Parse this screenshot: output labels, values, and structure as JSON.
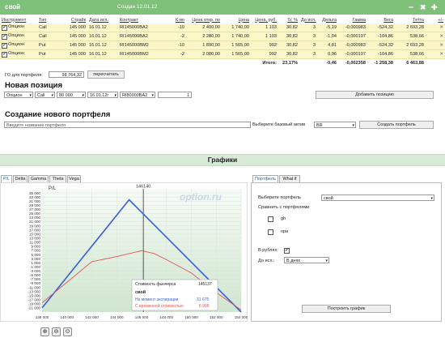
{
  "portfolio": {
    "name": "свой",
    "created": "Создан 12.01.12",
    "controls": {
      "minimize": "–",
      "close": "✖",
      "add": "✚"
    },
    "columns": [
      "Инструмент",
      "Тип",
      "Страйк",
      "Дата исп.",
      "Контракт",
      "К-во",
      "Цена откр. по",
      "Цена",
      "Цена, руб.",
      "IV, %",
      "До исп.",
      "Дельта",
      "Гамма",
      "Вега",
      "Тетта",
      "+/-"
    ],
    "rows": [
      {
        "checked": "✔",
        "instrument": "Опцион",
        "type": "Call",
        "strike": "145 000",
        "date": "16.01.12",
        "contract": "RI145000BA2",
        "qty": "-10",
        "open_price": "2 400,00",
        "price": "1 740,00",
        "price_rub": "1 103",
        "iv": "30,82",
        "days": "3",
        "delta": "-5,19",
        "gamma": "-0,000983",
        "vega": "-524,32",
        "theta": "2 693,28",
        "remove": "✕"
      },
      {
        "checked": "✔",
        "instrument": "Опцион",
        "type": "Call",
        "strike": "145 000",
        "date": "16.01.12",
        "contract": "RI145000BA2",
        "qty": "-2",
        "open_price": "2 280,00",
        "price": "1 740,00",
        "price_rub": "1 103",
        "iv": "30,82",
        "days": "3",
        "delta": "-1,04",
        "gamma": "-0,000197",
        "vega": "-104,86",
        "theta": "538,66",
        "remove": "✕"
      },
      {
        "checked": "✔",
        "instrument": "Опцион",
        "type": "Put",
        "strike": "145 000",
        "date": "16.01.12",
        "contract": "RI145000BM2",
        "qty": "-10",
        "open_price": "1 890,00",
        "price": "1 565,00",
        "price_rub": "992",
        "iv": "30,82",
        "days": "3",
        "delta": "4,81",
        "gamma": "-0,000983",
        "vega": "-524,32",
        "theta": "2 693,28",
        "remove": "✕"
      },
      {
        "checked": "✔",
        "instrument": "Опцион",
        "type": "Put",
        "strike": "145 000",
        "date": "16.01.12",
        "contract": "RI145000BM2",
        "qty": "-2",
        "open_price": "2 080,00",
        "price": "1 565,00",
        "price_rub": "992",
        "iv": "30,82",
        "days": "3",
        "delta": "0,96",
        "gamma": "-0,000197",
        "vega": "-104,86",
        "theta": "538,66",
        "remove": "✕"
      }
    ],
    "totals": {
      "label": "Итого:",
      "pct": "23,17%",
      "delta": "-0,46",
      "gamma": "-0,002358",
      "vega": "-1 258,38",
      "theta": "6 463,88"
    },
    "go_label": "ГО для портфеля:",
    "go_value": "98 764,32",
    "recalc": "пересчитать"
  },
  "new_position": {
    "title": "Новая позиция",
    "instrument": "Опцион",
    "type": "Call",
    "strike": "80 000",
    "date": "16.01.12г",
    "contract": "RI80000BA2",
    "qty": "1",
    "add_button": "Добавить позицию"
  },
  "new_portfolio": {
    "title": "Создание нового портфеля",
    "name_placeholder": "Введите название портфеля",
    "base_label": "Выберите базовый актив",
    "base_value": "BR",
    "create_button": "Создать портфель"
  },
  "charts": {
    "title": "Графики",
    "tabs": [
      "P/L",
      "Delta",
      "Gamma",
      "Theta",
      "Vega"
    ],
    "active_tab": "P/L",
    "watermark": "option.ru",
    "ylabel": "P/L",
    "cursor_label": "146140",
    "zoom_icons": [
      "zoom-in-icon",
      "zoom-out-icon",
      "zoom-reset-icon"
    ]
  },
  "chart_data": {
    "type": "line",
    "ylabel": "P/L",
    "xlim": [
      138000,
      154000
    ],
    "ylim": [
      -23000,
      37000
    ],
    "x_ticks": [
      "138 000",
      "140 000",
      "142 000",
      "144 000",
      "146 000",
      "148 000",
      "150 000",
      "152 000",
      "154 000"
    ],
    "y_ticks": [
      "35 000",
      "33 000",
      "31 000",
      "29 000",
      "27 000",
      "25 000",
      "23 000",
      "21 000",
      "19 000",
      "17 000",
      "15 000",
      "13 000",
      "11 000",
      "9 000",
      "7 000",
      "5 000",
      "3 000",
      "1 000",
      "-1 000",
      "-3 000",
      "-5 000",
      "-7 000",
      "-9 000",
      "-11 000",
      "-13 000",
      "-15 000",
      "-17 000",
      "-19 000",
      "-21 000"
    ],
    "series": [
      {
        "name": "На момент экспирации",
        "color": "#3a5fd8",
        "points": [
          [
            138000,
            -21000
          ],
          [
            145000,
            31675
          ],
          [
            154000,
            -23000
          ]
        ]
      },
      {
        "name": "С временной стоимостью",
        "color": "#e05656",
        "points": [
          [
            138000,
            -18500
          ],
          [
            142000,
            1500
          ],
          [
            144000,
            4000
          ],
          [
            146000,
            6900
          ],
          [
            147000,
            5500
          ],
          [
            148000,
            2500
          ],
          [
            150000,
            -4000
          ],
          [
            152000,
            -13500
          ],
          [
            154000,
            -22000
          ]
        ]
      }
    ],
    "tooltip": {
      "futures_label": "Стоимость фьючерса",
      "futures_value": "145137",
      "portfolio": "свой",
      "expiry_label": "На момент экспирации",
      "expiry_value": "31 675",
      "time_label": "С временной стоимостью",
      "time_value": "6 906"
    }
  },
  "right_panel": {
    "tabs": [
      "Портфель",
      "What if"
    ],
    "active_tab": "Портфель",
    "choose_label": "Выберите портфель",
    "choose_value": "свой",
    "compare_label": "Сравнить с портфелями",
    "compare_items": [
      "gh",
      "пpи"
    ],
    "rub_label": "В рублях:",
    "rub_checked": "✔",
    "to_exp_label": "До исп.:",
    "to_exp_value": "В днях",
    "build_button": "Построить график"
  }
}
